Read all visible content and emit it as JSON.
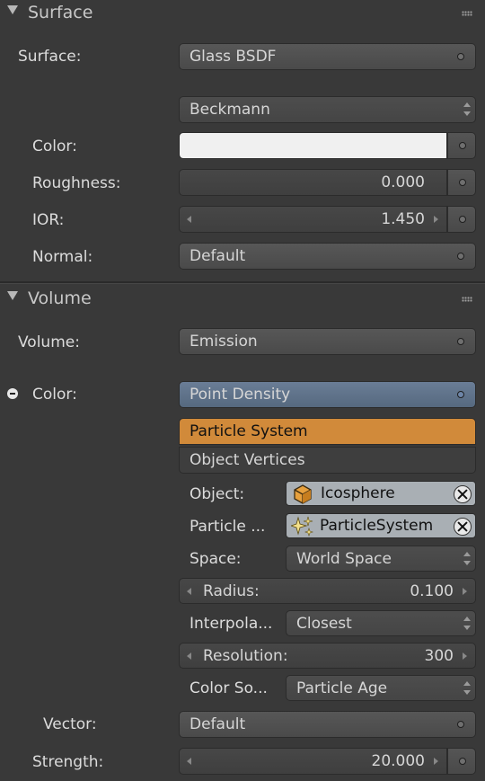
{
  "surface_panel": {
    "title": "Surface",
    "surface_label": "Surface:",
    "surface_value": "Glass BSDF",
    "distribution_value": "Beckmann",
    "color_label": "Color:",
    "color_value": "#f0f0f0",
    "roughness_label": "Roughness:",
    "roughness_value": "0.000",
    "ior_label": "IOR:",
    "ior_value": "1.450",
    "normal_label": "Normal:",
    "normal_value": "Default"
  },
  "volume_panel": {
    "title": "Volume",
    "volume_label": "Volume:",
    "volume_value": "Emission",
    "color_label": "Color:",
    "color_value": "Point Density",
    "point_source_options": [
      "Particle System",
      "Object Vertices"
    ],
    "point_source_selected": "Particle System",
    "object_label": "Object:",
    "object_value": "Icosphere",
    "particle_label": "Particle ...",
    "particle_value": "ParticleSystem",
    "space_label": "Space:",
    "space_value": "World Space",
    "radius_label": "Radius:",
    "radius_value": "0.100",
    "interpolation_label": "Interpola...",
    "interpolation_value": "Closest",
    "resolution_label": "Resolution:",
    "resolution_value": "300",
    "color_source_label": "Color So...",
    "color_source_value": "Particle Age",
    "vector_label": "Vector:",
    "vector_value": "Default",
    "strength_label": "Strength:",
    "strength_value": "20.000"
  },
  "colors": {
    "selected_option": "#d18a3a",
    "point_density_field": "#5c6f88",
    "id_field": "#a9afb4"
  },
  "icons": {
    "object_icon": "cube-icon",
    "particle_icon": "sparkle-icon"
  }
}
